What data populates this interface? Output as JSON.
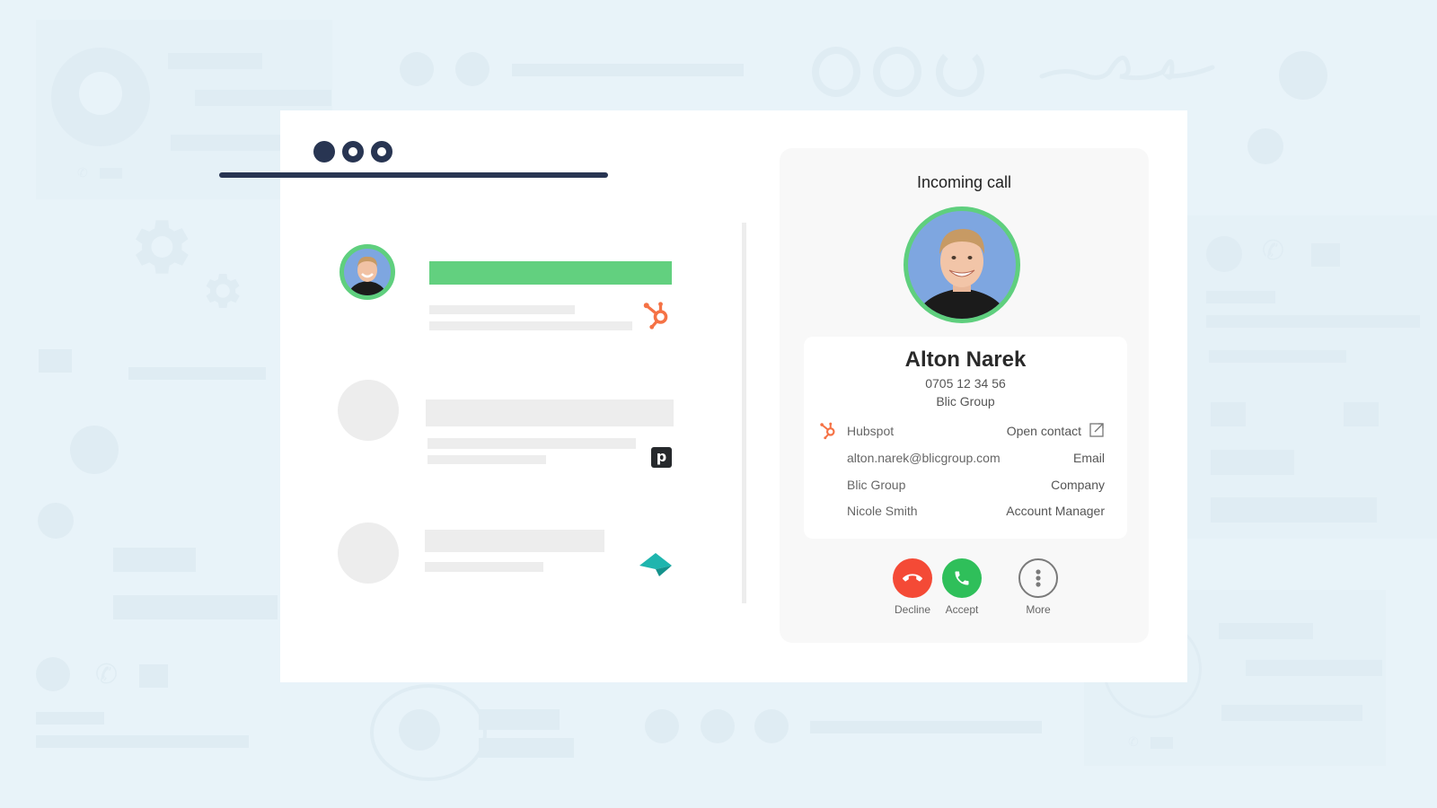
{
  "window": {
    "traffic_lights": [
      "close",
      "minimize",
      "maximize"
    ]
  },
  "contact_list": {
    "items": [
      {
        "state": "active",
        "integration": "hubspot-icon",
        "highlight_color": "#62d07f"
      },
      {
        "state": "placeholder",
        "integration": "pipedrive-icon"
      },
      {
        "state": "placeholder",
        "integration": "teamleader-icon"
      }
    ]
  },
  "call_panel": {
    "title": "Incoming call",
    "caller": {
      "name": "Alton Narek",
      "phone": "0705 12 34 56",
      "company": "Blic Group"
    },
    "crm": {
      "source": "Hubspot",
      "open_contact_label": "Open contact",
      "rows": [
        {
          "value": "alton.narek@blicgroup.com",
          "label": "Email"
        },
        {
          "value": "Blic Group",
          "label": "Company"
        },
        {
          "value": "Nicole Smith",
          "label": "Account Manager"
        }
      ]
    },
    "actions": {
      "decline": "Decline",
      "accept": "Accept",
      "more": "More"
    }
  },
  "colors": {
    "background": "#e8f3f9",
    "accent_green": "#5fcf7e",
    "decline_red": "#f44a36",
    "accept_green": "#2fbf5a",
    "hubspot_orange": "#f57245",
    "pipedrive_dark": "#26292c",
    "teamleader_teal": "#1fb5ae",
    "navy": "#283552"
  }
}
